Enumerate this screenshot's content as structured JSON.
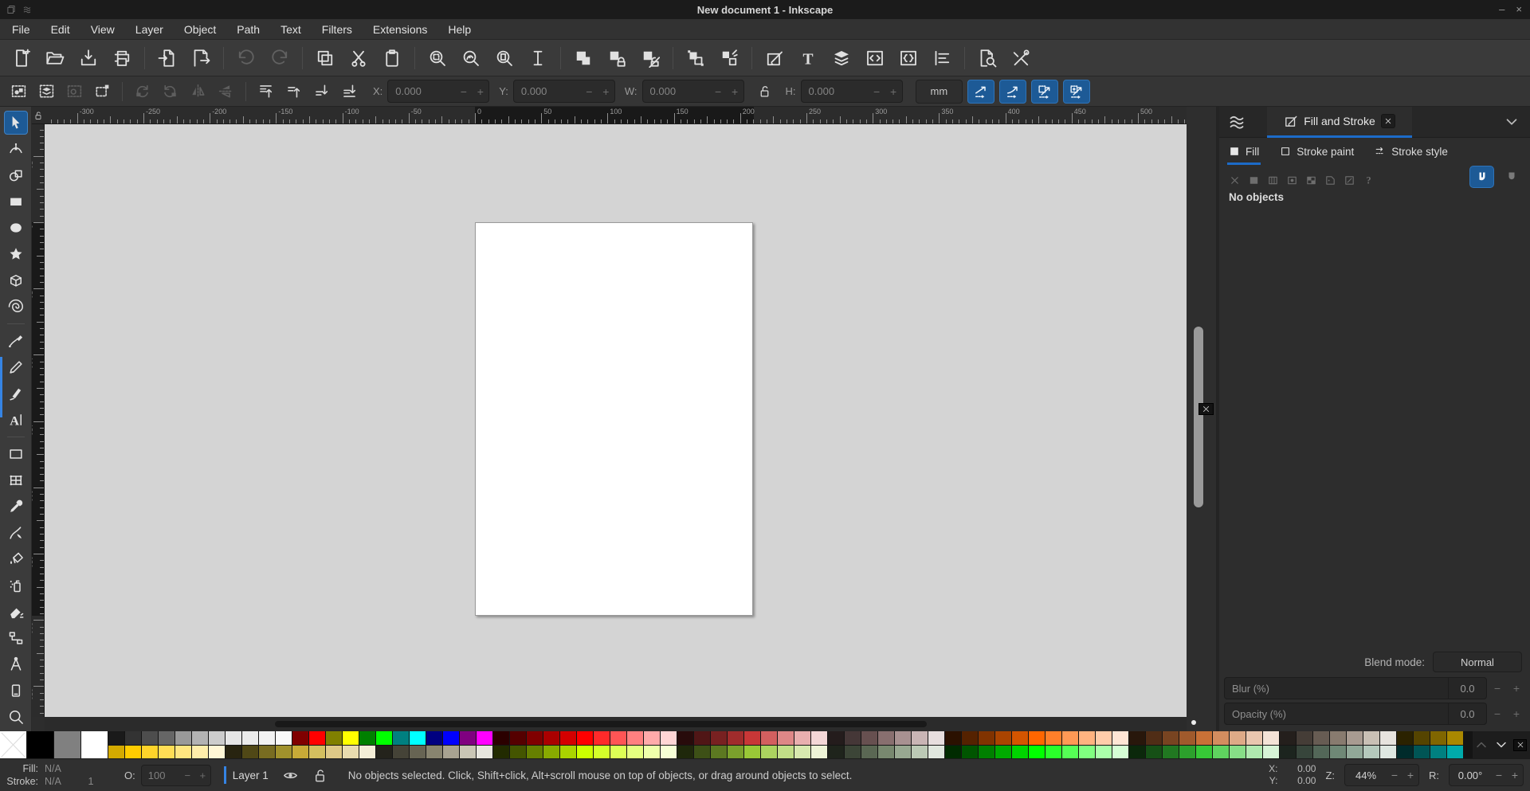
{
  "window": {
    "title": "New document 1 - Inkscape",
    "minimize": "–",
    "close": "×"
  },
  "menubar": {
    "items": [
      "File",
      "Edit",
      "View",
      "Layer",
      "Object",
      "Path",
      "Text",
      "Filters",
      "Extensions",
      "Help"
    ]
  },
  "commandbar": {
    "items": [
      {
        "icon": "new",
        "name": "new-document"
      },
      {
        "icon": "open",
        "name": "open-document"
      },
      {
        "icon": "save",
        "name": "save-document"
      },
      {
        "icon": "print",
        "name": "print-document"
      },
      {
        "sep": true
      },
      {
        "icon": "import",
        "name": "import"
      },
      {
        "icon": "export",
        "name": "export"
      },
      {
        "sep": true
      },
      {
        "icon": "undo",
        "name": "undo",
        "disabled": true
      },
      {
        "icon": "redo",
        "name": "redo",
        "disabled": true
      },
      {
        "sep": true
      },
      {
        "icon": "copy",
        "name": "copy"
      },
      {
        "icon": "cut",
        "name": "cut"
      },
      {
        "icon": "paste",
        "name": "paste"
      },
      {
        "sep": true
      },
      {
        "icon": "zoomsel",
        "name": "zoom-to-selection"
      },
      {
        "icon": "zoomdraw",
        "name": "zoom-to-drawing"
      },
      {
        "icon": "zoompage",
        "name": "zoom-to-page"
      },
      {
        "icon": "zoomwidth",
        "name": "zoom-page-width"
      },
      {
        "sep": true
      },
      {
        "icon": "duplicate",
        "name": "duplicate"
      },
      {
        "icon": "clone",
        "name": "create-clone"
      },
      {
        "icon": "unlink",
        "name": "unlink-clone"
      },
      {
        "sep": true
      },
      {
        "icon": "group",
        "name": "group"
      },
      {
        "icon": "ungroup",
        "name": "ungroup"
      },
      {
        "sep": true
      },
      {
        "icon": "fillstroke",
        "name": "fill-stroke-dialog"
      },
      {
        "icon": "textdlg",
        "name": "text-dialog"
      },
      {
        "icon": "layers",
        "name": "layers-dialog"
      },
      {
        "icon": "xml",
        "name": "xml-editor"
      },
      {
        "icon": "objprops",
        "name": "object-properties-dialog"
      },
      {
        "icon": "align",
        "name": "align-distribute-dialog"
      },
      {
        "sep": true
      },
      {
        "icon": "docprops",
        "name": "document-properties"
      },
      {
        "icon": "prefs",
        "name": "preferences"
      }
    ]
  },
  "tool_options": {
    "buttons": [
      {
        "icon": "selall",
        "name": "select-all"
      },
      {
        "icon": "selalllayers",
        "name": "select-all-in-all-layers"
      },
      {
        "icon": "deselect",
        "name": "deselect",
        "disabled": true
      },
      {
        "icon": "selbox",
        "name": "selection-box"
      },
      {
        "sep": true
      },
      {
        "icon": "rotccw",
        "name": "rotate-90-ccw",
        "disabled": true
      },
      {
        "icon": "rotcw",
        "name": "rotate-90-cw",
        "disabled": true
      },
      {
        "icon": "fliph",
        "name": "flip-horizontal",
        "disabled": true
      },
      {
        "icon": "flipv",
        "name": "flip-vertical",
        "disabled": true
      },
      {
        "sep": true
      },
      {
        "icon": "raisetop",
        "name": "raise-to-top"
      },
      {
        "icon": "raise",
        "name": "raise-one-step"
      },
      {
        "icon": "lower",
        "name": "lower-one-step"
      },
      {
        "icon": "lowerbottom",
        "name": "lower-to-bottom"
      }
    ],
    "fields": [
      {
        "label": "X:",
        "value": "0.000",
        "name": "x-field"
      },
      {
        "label": "Y:",
        "value": "0.000",
        "name": "y-field"
      },
      {
        "label": "W:",
        "value": "0.000",
        "name": "w-field"
      }
    ],
    "h_field": {
      "label": "H:",
      "value": "0.000",
      "name": "h-field"
    },
    "unit": "mm",
    "toggles": [
      {
        "icon": "tscale1",
        "name": "toggle-scale-stroke-width"
      },
      {
        "icon": "tscale2",
        "name": "toggle-scale-rounded-corners"
      },
      {
        "icon": "tscale3",
        "name": "toggle-move-gradients"
      },
      {
        "icon": "tscale4",
        "name": "toggle-move-patterns"
      }
    ]
  },
  "toolbox": {
    "tools": [
      {
        "icon": "selector",
        "name": "selector-tool",
        "active": true
      },
      {
        "icon": "node",
        "name": "node-tool"
      },
      {
        "icon": "shapebuilder",
        "name": "shape-builder-tool"
      },
      {
        "icon": "rect",
        "name": "rectangle-tool"
      },
      {
        "icon": "ellipse",
        "name": "ellipse-tool"
      },
      {
        "icon": "star",
        "name": "star-tool"
      },
      {
        "icon": "box3d",
        "name": "3d-box-tool"
      },
      {
        "icon": "spiral",
        "name": "spiral-tool"
      },
      {
        "sep": true
      },
      {
        "icon": "pen",
        "name": "pen-tool"
      },
      {
        "icon": "pencil",
        "name": "pencil-tool"
      },
      {
        "icon": "calligraphy",
        "name": "calligraphy-tool"
      },
      {
        "icon": "texttool",
        "name": "text-tool"
      },
      {
        "sep": true
      },
      {
        "icon": "gradient",
        "name": "gradient-tool"
      },
      {
        "icon": "mesh",
        "name": "mesh-gradient-tool"
      },
      {
        "icon": "dropper",
        "name": "dropper-tool"
      },
      {
        "icon": "tweak",
        "name": "tweak-tool"
      },
      {
        "icon": "bucket",
        "name": "paint-bucket-tool"
      },
      {
        "icon": "spray",
        "name": "spray-tool"
      },
      {
        "icon": "eraser",
        "name": "eraser-tool"
      },
      {
        "icon": "connector",
        "name": "connector-tool"
      },
      {
        "icon": "measure",
        "name": "measure-tool"
      },
      {
        "icon": "pagetool",
        "name": "page-tool"
      },
      {
        "icon": "zoomtool",
        "name": "zoom-tool"
      },
      {
        "icon": "pages",
        "name": "pages-tool"
      }
    ]
  },
  "rulers": {
    "h_labels": [
      -300,
      -250,
      -200,
      -150,
      -100,
      -50,
      0,
      50,
      100,
      150,
      200,
      250,
      300,
      350,
      400,
      450,
      500
    ],
    "v_labels": [
      -50,
      0,
      50,
      100,
      150,
      200,
      250,
      300,
      350
    ]
  },
  "panel": {
    "dock_tab": "Fill and Stroke",
    "tabs": [
      "Fill",
      "Stroke paint",
      "Stroke style"
    ],
    "active_tab": "Fill",
    "paint_types": [
      {
        "icon": "px",
        "name": "no-paint"
      },
      {
        "icon": "pflat",
        "name": "flat-color"
      },
      {
        "icon": "plin",
        "name": "linear-gradient"
      },
      {
        "icon": "prad",
        "name": "radial-gradient"
      },
      {
        "icon": "ppat",
        "name": "pattern"
      },
      {
        "icon": "pswatch",
        "name": "swatch"
      },
      {
        "icon": "punk",
        "name": "unknown-paint"
      },
      {
        "icon": "pq",
        "name": "paint-help"
      }
    ],
    "no_objects": "No objects",
    "blend_label": "Blend mode:",
    "blend_value": "Normal",
    "blur_label": "Blur (%)",
    "blur_value": "0.0",
    "opacity_label": "Opacity (%)",
    "opacity_value": "0.0"
  },
  "palette": {
    "big": [
      "none",
      "#000000",
      "#808080",
      "#ffffff"
    ],
    "row1": [
      "#1a1a1a",
      "#333333",
      "#4d4d4d",
      "#666666",
      "#999999",
      "#b3b3b3",
      "#cccccc",
      "#e6e6e6",
      "#ececec",
      "#f2f2f2",
      "#f9f9f9",
      "#800000",
      "#ff0000",
      "#808000",
      "#ffff00",
      "#008000",
      "#00ff00",
      "#008080",
      "#00ffff",
      "#000080",
      "#0000ff",
      "#800080",
      "#ff00ff",
      "#2b0000",
      "#550000",
      "#800000",
      "#aa0000",
      "#d40000",
      "#ff0000",
      "#ff2a2a",
      "#ff5555",
      "#ff8080",
      "#ffaaaa",
      "#ffd5d5",
      "#280b0b",
      "#501616",
      "#782121",
      "#a02c2c",
      "#c83737",
      "#d35f5f",
      "#de8787",
      "#e9afaf",
      "#f4d7d7",
      "#241c1c",
      "#453737",
      "#675050",
      "#886f6f",
      "#a89191",
      "#c9b5b5",
      "#e7dede",
      "#2b1100",
      "#552200",
      "#803300",
      "#aa4400",
      "#d45500",
      "#ff6600",
      "#ff7f2a",
      "#ff9955",
      "#ffb380",
      "#ffccaa",
      "#ffe6d5",
      "#28170b",
      "#502d16",
      "#784421",
      "#a05a2c",
      "#c87137",
      "#d38d5f",
      "#deaa87",
      "#e9c6af",
      "#f4e3d7",
      "#241f1c",
      "#453d37",
      "#675c53",
      "#887b6f",
      "#a89b91",
      "#c9c0b5",
      "#e7e3de",
      "#2b2200",
      "#554400",
      "#806600",
      "#aa8800"
    ],
    "row2": [
      "#d4aa00",
      "#ffcc00",
      "#ffd42a",
      "#ffdd55",
      "#ffe680",
      "#ffeeaa",
      "#fff6d5",
      "#282410",
      "#504816",
      "#786c21",
      "#a0912c",
      "#c8ab37",
      "#d3bf5f",
      "#dec987",
      "#e9dcaf",
      "#f4eed7",
      "#24231c",
      "#454337",
      "#676453",
      "#88846f",
      "#a8a391",
      "#c9c6b5",
      "#e7e6de",
      "#222b00",
      "#445500",
      "#668000",
      "#88aa00",
      "#aad400",
      "#ccff00",
      "#d4ff2a",
      "#ddff55",
      "#e5ff80",
      "#eeffaa",
      "#f6ffd5",
      "#1f280b",
      "#3d5016",
      "#5c7821",
      "#7aa02c",
      "#99c837",
      "#abd35f",
      "#c1de87",
      "#d8e9af",
      "#eef4d7",
      "#1f241c",
      "#3c4537",
      "#5a6753",
      "#78886f",
      "#98a891",
      "#bbc9b5",
      "#e0e7de",
      "#002b00",
      "#005500",
      "#008000",
      "#00aa00",
      "#00d400",
      "#00ff00",
      "#2aff2a",
      "#55ff55",
      "#80ff80",
      "#aaffaa",
      "#d5ffd5",
      "#0b280b",
      "#165016",
      "#217821",
      "#2ca02c",
      "#37c837",
      "#5fd35f",
      "#87de87",
      "#afe9af",
      "#d7f4d7",
      "#1c241e",
      "#37453b",
      "#536758",
      "#6f8876",
      "#91a898",
      "#b5c9bc",
      "#dee7e1",
      "#002b2b",
      "#005555",
      "#008080",
      "#00aaaa"
    ]
  },
  "statusbar": {
    "fill_label": "Fill:",
    "fill_value": "N/A",
    "stroke_label": "Stroke:",
    "stroke_value": "N/A",
    "stroke_width": "1",
    "opacity_label": "O:",
    "opacity_value": "100",
    "layer_label": "Layer 1",
    "message": "No objects selected. Click, Shift+click, Alt+scroll mouse on top of objects, or drag around objects to select.",
    "x_label": "X:",
    "x_value": "0.00",
    "y_label": "Y:",
    "y_value": "0.00",
    "zoom_label": "Z:",
    "zoom_value": "44%",
    "rotation_label": "R:",
    "rotation_value": "0.00°"
  },
  "colors": {
    "accent": "#3584e4",
    "toggle_active": "#1d5a96",
    "canvas": "#d4d4d4",
    "page": "#ffffff",
    "tab_underline": "#1c6bc8"
  }
}
